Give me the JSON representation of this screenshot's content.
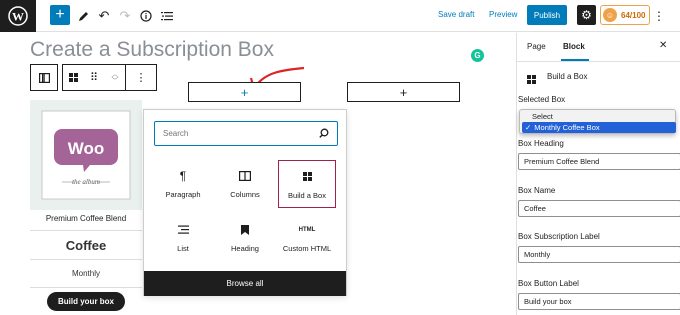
{
  "topbar": {
    "save_draft": "Save draft",
    "preview": "Preview",
    "publish": "Publish",
    "seo_score": "64/100",
    "accent": "#007cba"
  },
  "editor": {
    "title": "Create a Subscription Box"
  },
  "product": {
    "logo_text": "Woo",
    "logo_sub": "the album",
    "name": "Premium Coffee Blend",
    "heading": "Coffee",
    "subscription_label": "Monthly",
    "button": "Build your box"
  },
  "inserter": {
    "search_placeholder": "Search",
    "blocks": [
      {
        "label": "Paragraph",
        "icon": "paragraph-icon"
      },
      {
        "label": "Columns",
        "icon": "columns-icon"
      },
      {
        "label": "Build a Box",
        "icon": "grid-icon"
      },
      {
        "label": "List",
        "icon": "list-icon"
      },
      {
        "label": "Heading",
        "icon": "bookmark-icon"
      },
      {
        "label": "Custom HTML",
        "icon": "html-icon"
      }
    ],
    "browse_all": "Browse all",
    "html_glyph": "HTML"
  },
  "sidebar": {
    "tab_page": "Page",
    "tab_block": "Block",
    "block_name": "Build a Box",
    "selected_box_label": "Selected Box",
    "dropdown_options": [
      "Select",
      "Monthly Coffee Box"
    ],
    "box_heading_label": "Box Heading",
    "box_heading_value": "Premium Coffee Blend",
    "box_name_label": "Box Name",
    "box_name_value": "Coffee",
    "box_subscription_label": "Box Subscription Label",
    "box_subscription_value": "Monthly",
    "box_button_label": "Box Button Label",
    "box_button_value": "Build your box"
  }
}
